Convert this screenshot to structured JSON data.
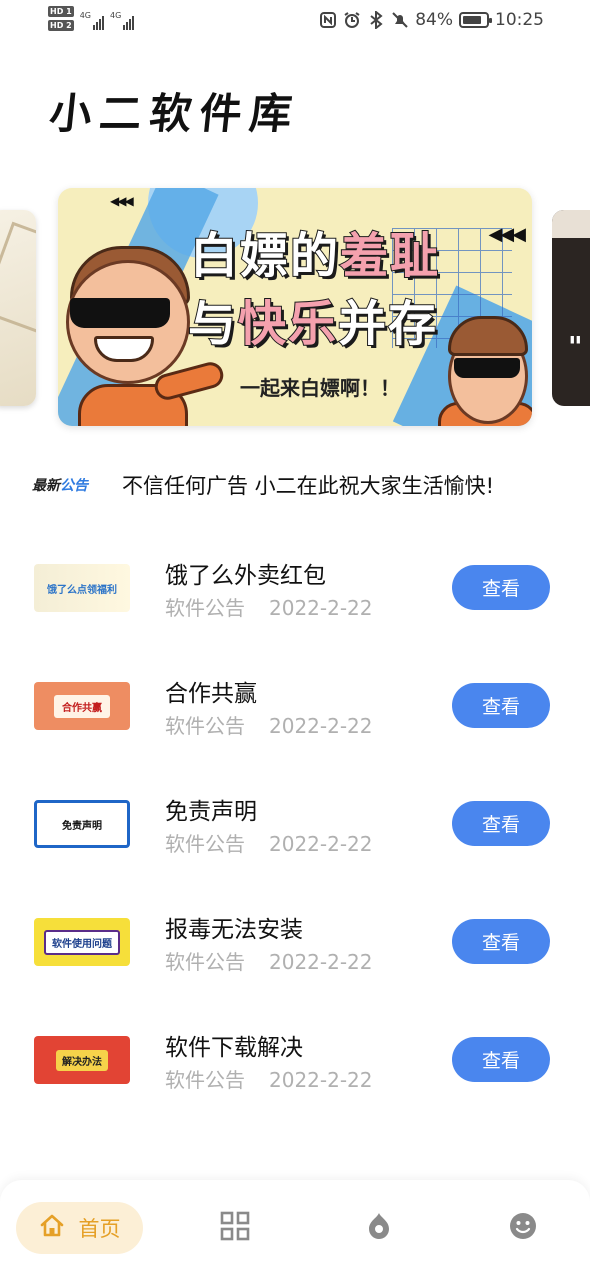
{
  "status_bar": {
    "hd1": "HD 1",
    "hd2": "HD 2",
    "net1": "4G",
    "net2": "4G",
    "battery": "84%",
    "time": "10:25",
    "battery_level": 0.84,
    "icons": [
      "nfc-icon",
      "alarm-icon",
      "bluetooth-icon",
      "mute-icon",
      "battery-icon"
    ]
  },
  "header": {
    "logo_text": "小二软件库"
  },
  "banner": {
    "title_line1_a": "白嫖的",
    "title_line1_b": "羞耻",
    "title_line2_a": "与",
    "title_line2_b": "快乐",
    "title_line2_c": "并存",
    "subtitle": "一起来白嫖啊！！",
    "arrows_small": "◀◀◀",
    "arrows_large": "◀◀◀",
    "next_quote": "\"",
    "colors": {
      "background": "#f6eebd",
      "accent_blue": "#58a9e6",
      "accent_pink": "#f4a1ae"
    }
  },
  "notice": {
    "badge_a": "最新",
    "badge_b": "公告",
    "text": "不信任何广告 小二在此祝大家生活愉快!"
  },
  "list": {
    "button_label": "查看",
    "items": [
      {
        "title": "饿了么外卖红包",
        "category": "软件公告",
        "date": "2022-2-22",
        "thumb_text": "饿了么点领福利"
      },
      {
        "title": "合作共赢",
        "category": "软件公告",
        "date": "2022-2-22",
        "thumb_text": "合作共赢"
      },
      {
        "title": "免责声明",
        "category": "软件公告",
        "date": "2022-2-22",
        "thumb_text": "免责声明"
      },
      {
        "title": "报毒无法安装",
        "category": "软件公告",
        "date": "2022-2-22",
        "thumb_text": "软件使用问题"
      },
      {
        "title": "软件下载解决",
        "category": "软件公告",
        "date": "2022-2-22",
        "thumb_text": "解决办法"
      }
    ]
  },
  "bottom_nav": {
    "home_label": "首页",
    "items": [
      "home-icon",
      "apps-grid-icon",
      "discover-icon",
      "profile-smile-icon"
    ],
    "active_color": "#e5a027",
    "active_bg": "#fcefd6"
  },
  "accent_color": "#4a86ee"
}
